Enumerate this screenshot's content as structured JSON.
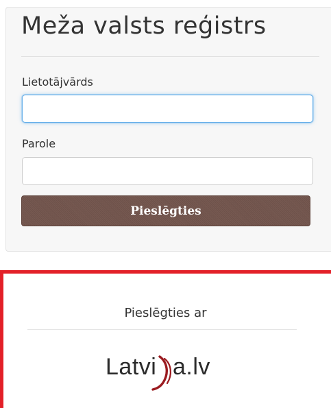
{
  "login_form": {
    "title": "Meža valsts reģistrs",
    "username_label": "Lietotājvārds",
    "username_value": "",
    "password_label": "Parole",
    "password_value": "",
    "submit_label": "Pieslēgties"
  },
  "alt_login": {
    "heading": "Pieslēgties ar",
    "provider_logo_text": "Latvija.lv"
  },
  "colors": {
    "panel_background": "#f7f7f7",
    "button_background": "#72544c",
    "focus_border": "#66afe9",
    "highlight_border": "#e32028",
    "logo_accent": "#9b1b20"
  }
}
